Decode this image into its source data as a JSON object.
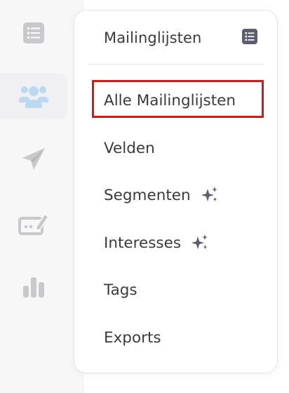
{
  "sidebar": {
    "icons": [
      {
        "name": "list-icon",
        "active": false
      },
      {
        "name": "users-icon",
        "active": true
      },
      {
        "name": "send-icon",
        "active": false
      },
      {
        "name": "edit-form-icon",
        "active": false
      },
      {
        "name": "bar-chart-icon",
        "active": false
      }
    ]
  },
  "menu": {
    "title": "Mailinglijsten",
    "header_icon": "list-icon",
    "items": [
      {
        "label": "Alle Mailinglijsten",
        "highlighted": true,
        "sparkle": false
      },
      {
        "label": "Velden",
        "highlighted": false,
        "sparkle": false
      },
      {
        "label": "Segmenten",
        "highlighted": false,
        "sparkle": true
      },
      {
        "label": "Interesses",
        "highlighted": false,
        "sparkle": true
      },
      {
        "label": "Tags",
        "highlighted": false,
        "sparkle": false
      },
      {
        "label": "Exports",
        "highlighted": false,
        "sparkle": false
      }
    ]
  },
  "colors": {
    "icon_gray": "#c9c9cd",
    "active_icon": "#bcd9f2",
    "text": "#3a3a40",
    "highlight_border": "#e01414",
    "sparkle": "#5a5e6e"
  }
}
